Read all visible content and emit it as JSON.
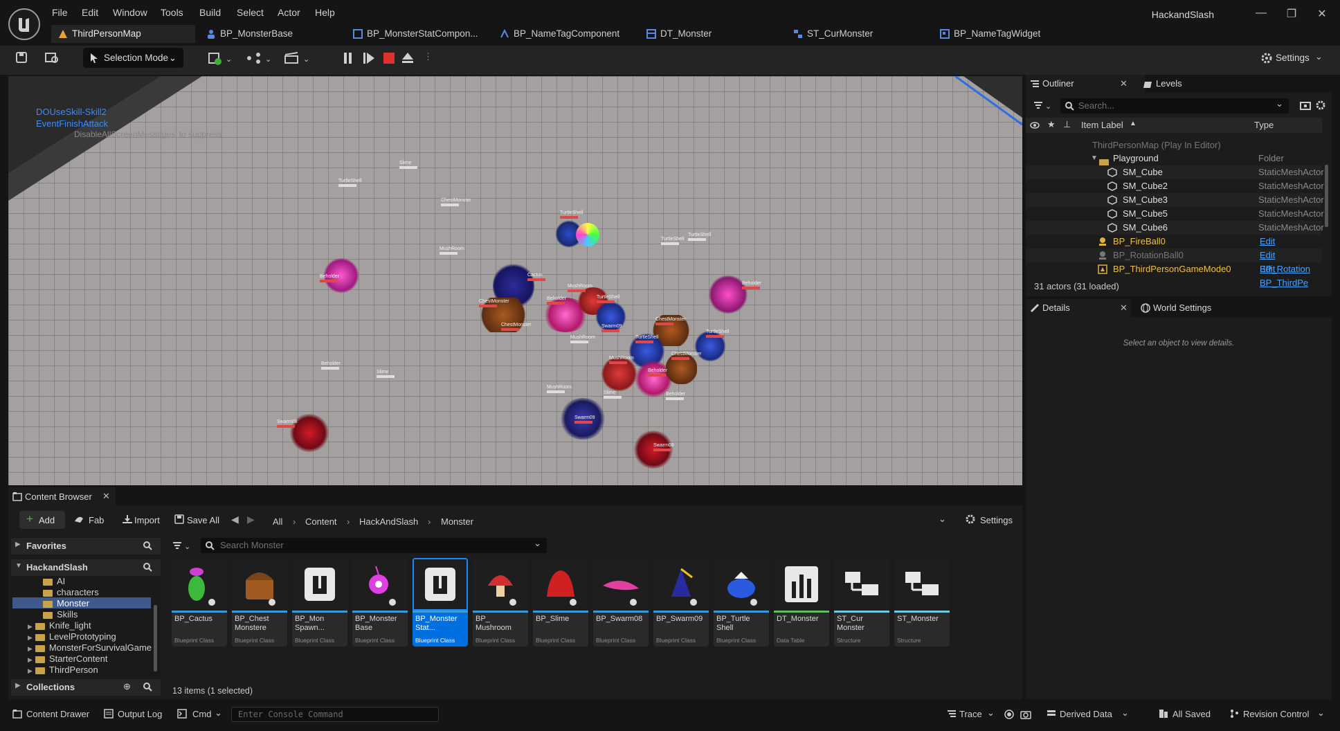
{
  "app": {
    "title": "HackandSlash"
  },
  "menu": [
    "File",
    "Edit",
    "Window",
    "Tools",
    "Build",
    "Select",
    "Actor",
    "Help"
  ],
  "doc_tabs": [
    "ThirdPersonMap",
    "BP_MonsterBase",
    "BP_MonsterStatCompon...",
    "BP_NameTagComponent",
    "DT_Monster",
    "ST_CurMonster",
    "BP_NameTagWidget"
  ],
  "toolbar": {
    "selection_mode": "Selection Mode",
    "settings": "Settings"
  },
  "viewport": {
    "debug_lines": [
      "DOUseSkill-Skill2",
      "EventFinishAttack"
    ],
    "suppress_hint": "DisableAllScreenMessages' to suppress",
    "name_tags": [
      "Slime",
      "TurtleShell",
      "ChestMonster",
      "TurtleShell",
      "MushRoom",
      "Beholder",
      "TurtleShell",
      "TurtleShell",
      "Beholder",
      "Cactus",
      "ChestMonster",
      "MushRoom",
      "Beholder",
      "TurtleShell",
      "Swarm09",
      "ChestMonster",
      "MushRoom",
      "TurtleShell",
      "TurtleShell",
      "ChestMonster",
      "MushRoom",
      "Beholder",
      "Beholder",
      "Slime",
      "MushRoom",
      "Slime",
      "Beholder",
      "Swarm08",
      "Swarm09",
      "Swarm08",
      "ChestMonster"
    ]
  },
  "outliner": {
    "tab": "Outliner",
    "levels_tab": "Levels",
    "search_placeholder": "Search...",
    "col_label": "Item Label",
    "col_type": "Type",
    "root": "ThirdPersonMap (Play In Editor)",
    "rows": [
      {
        "name": "Playground",
        "type": "Folder"
      },
      {
        "name": "SM_Cube",
        "type": "StaticMeshActor"
      },
      {
        "name": "SM_Cube2",
        "type": "StaticMeshActor"
      },
      {
        "name": "SM_Cube3",
        "type": "StaticMeshActor"
      },
      {
        "name": "SM_Cube5",
        "type": "StaticMeshActor"
      },
      {
        "name": "SM_Cube6",
        "type": "StaticMeshActor"
      },
      {
        "name": "BP_FireBall0",
        "type": "Edit BP_FireBall"
      },
      {
        "name": "BP_RotationBall0",
        "type": "Edit BP_Rotation"
      },
      {
        "name": "BP_ThirdPersonGameMode0",
        "type": "Edit BP_ThirdPe"
      }
    ],
    "count": "31 actors (31 loaded)"
  },
  "details": {
    "tab": "Details",
    "world_tab": "World Settings",
    "empty": "Select an object to view details."
  },
  "content_browser": {
    "tab": "Content Browser",
    "add": "Add",
    "fab": "Fab",
    "import": "Import",
    "save_all": "Save All",
    "settings": "Settings",
    "breadcrumb": [
      "All",
      "Content",
      "HackAndSlash",
      "Monster"
    ],
    "favorites": "Favorites",
    "root_folder": "HackandSlash",
    "folders": [
      "AI",
      "characters",
      "Monster",
      "Skills",
      "Knife_light",
      "LevelPrototyping",
      "MonsterForSurvivalGame",
      "StarterContent",
      "ThirdPerson"
    ],
    "collections": "Collections",
    "search_placeholder": "Search Monster",
    "assets": [
      {
        "name": "BP_Cactus",
        "type": "Blueprint Class",
        "color": "#3a9ad9"
      },
      {
        "name": "BP_Chest Monstere",
        "type": "Blueprint Class",
        "color": "#3a9ad9"
      },
      {
        "name": "BP_Mon Spawn...",
        "type": "Blueprint Class",
        "color": "#3a9ad9"
      },
      {
        "name": "BP_Monster Base",
        "type": "Blueprint Class",
        "color": "#3a9ad9"
      },
      {
        "name": "BP_Monster Stat...",
        "type": "Blueprint Class",
        "color": "#3a9ad9"
      },
      {
        "name": "BP_ Mushroom",
        "type": "Blueprint Class",
        "color": "#3a9ad9"
      },
      {
        "name": "BP_Slime",
        "type": "Blueprint Class",
        "color": "#3a9ad9"
      },
      {
        "name": "BP_Swarm08",
        "type": "Blueprint Class",
        "color": "#3a9ad9"
      },
      {
        "name": "BP_Swarm09",
        "type": "Blueprint Class",
        "color": "#3a9ad9"
      },
      {
        "name": "BP_Turtle Shell",
        "type": "Blueprint Class",
        "color": "#3a9ad9"
      },
      {
        "name": "DT_Monster",
        "type": "Data Table",
        "color": "#5fbf5f"
      },
      {
        "name": "ST_Cur Monster",
        "type": "Structure",
        "color": "#6fc7e0"
      },
      {
        "name": "ST_Monster",
        "type": "Structure",
        "color": "#6fc7e0"
      }
    ],
    "status": "13 items (1 selected)"
  },
  "statusbar": {
    "content_drawer": "Content Drawer",
    "output_log": "Output Log",
    "cmd": "Cmd",
    "console_placeholder": "Enter Console Command",
    "trace": "Trace",
    "derived_data": "Derived Data",
    "all_saved": "All Saved",
    "revision_control": "Revision Control"
  }
}
